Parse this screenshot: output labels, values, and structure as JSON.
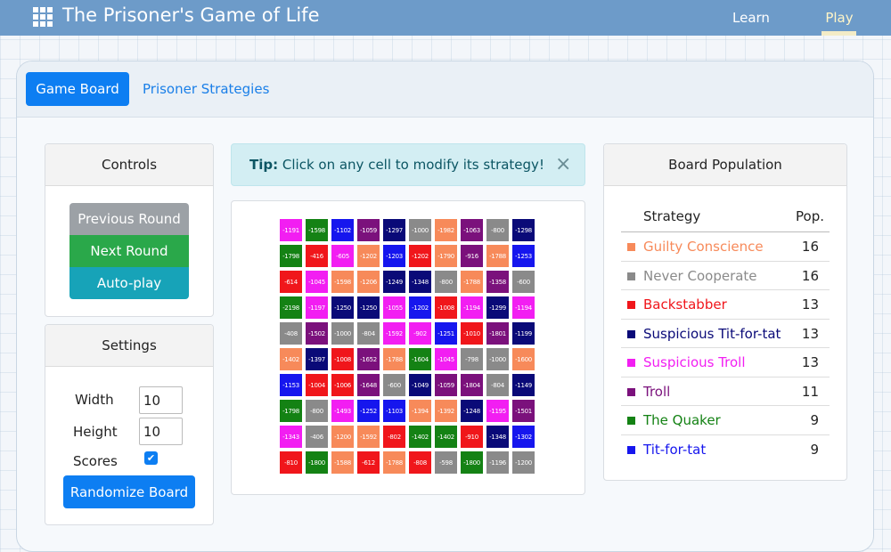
{
  "app": {
    "title": "The Prisoner's Game of Life"
  },
  "nav": {
    "learn": "Learn",
    "play": "Play"
  },
  "tabs": {
    "active": "Game Board",
    "other": "Prisoner Strategies"
  },
  "controls": {
    "title": "Controls",
    "previous": "Previous Round",
    "next": "Next Round",
    "autoplay": "Auto-play"
  },
  "settings": {
    "title": "Settings",
    "width_label": "Width",
    "width_value": "10",
    "height_label": "Height",
    "height_value": "10",
    "scores_label": "Scores",
    "scores_checked": true,
    "randomize": "Randomize Board"
  },
  "tip": {
    "label": "Tip:",
    "text": "Click on any cell to modify its strategy!",
    "close": "×"
  },
  "population": {
    "title": "Board Population",
    "col_strategy": "Strategy",
    "col_pop": "Pop.",
    "rows": [
      {
        "name": "Guilty Conscience",
        "count": "16",
        "color": "#f78a5a"
      },
      {
        "name": "Never Cooperate",
        "count": "16",
        "color": "#8a8a8a"
      },
      {
        "name": "Backstabber",
        "count": "13",
        "color": "#f0161b"
      },
      {
        "name": "Suspicious Tit-for-tat",
        "count": "13",
        "color": "#0a0a78"
      },
      {
        "name": "Suspicious Troll",
        "count": "13",
        "color": "#f21ef2"
      },
      {
        "name": "Troll",
        "count": "11",
        "color": "#7b117c"
      },
      {
        "name": "The Quaker",
        "count": "9",
        "color": "#148214"
      },
      {
        "name": "Tit-for-tat",
        "count": "9",
        "color": "#1616ee"
      }
    ]
  },
  "board": {
    "colors": {
      "P": "#f21ef2",
      "G": "#148214",
      "B": "#1616ee",
      "U": "#7b117c",
      "N": "#0a0a78",
      "Y": "#8a8a8a",
      "O": "#f78a5a",
      "R": "#f0161b"
    },
    "cells": [
      [
        [
          "P",
          "-1191"
        ],
        [
          "G",
          "-1598"
        ],
        [
          "B",
          "-1102"
        ],
        [
          "U",
          "-1059"
        ],
        [
          "N",
          "-1297"
        ],
        [
          "Y",
          "-1000"
        ],
        [
          "O",
          "-1982"
        ],
        [
          "U",
          "-1063"
        ],
        [
          "Y",
          "-800"
        ],
        [
          "N",
          "-1298"
        ]
      ],
      [
        [
          "G",
          "-1798"
        ],
        [
          "R",
          "-416"
        ],
        [
          "P",
          "-605"
        ],
        [
          "O",
          "-1202"
        ],
        [
          "B",
          "-1203"
        ],
        [
          "R",
          "-1202"
        ],
        [
          "O",
          "-1790"
        ],
        [
          "U",
          "-916"
        ],
        [
          "O",
          "-1788"
        ],
        [
          "B",
          "-1253"
        ]
      ],
      [
        [
          "R",
          "-614"
        ],
        [
          "P",
          "-1045"
        ],
        [
          "O",
          "-1598"
        ],
        [
          "O",
          "-1206"
        ],
        [
          "N",
          "-1249"
        ],
        [
          "N",
          "-1348"
        ],
        [
          "Y",
          "-800"
        ],
        [
          "O",
          "-1788"
        ],
        [
          "U",
          "-1358"
        ],
        [
          "Y",
          "-600"
        ]
      ],
      [
        [
          "G",
          "-2198"
        ],
        [
          "P",
          "-1197"
        ],
        [
          "N",
          "-1250"
        ],
        [
          "N",
          "-1250"
        ],
        [
          "P",
          "-1055"
        ],
        [
          "B",
          "-1202"
        ],
        [
          "R",
          "-1008"
        ],
        [
          "P",
          "-1194"
        ],
        [
          "N",
          "-1299"
        ],
        [
          "P",
          "-1194"
        ]
      ],
      [
        [
          "Y",
          "-408"
        ],
        [
          "U",
          "-1502"
        ],
        [
          "Y",
          "-1000"
        ],
        [
          "Y",
          "-804"
        ],
        [
          "P",
          "-1592"
        ],
        [
          "P",
          "-902"
        ],
        [
          "B",
          "-1251"
        ],
        [
          "R",
          "-1010"
        ],
        [
          "U",
          "-1801"
        ],
        [
          "N",
          "-1199"
        ]
      ],
      [
        [
          "O",
          "-1402"
        ],
        [
          "N",
          "-1397"
        ],
        [
          "R",
          "-1008"
        ],
        [
          "U",
          "-1652"
        ],
        [
          "O",
          "-1788"
        ],
        [
          "G",
          "-1604"
        ],
        [
          "P",
          "-1045"
        ],
        [
          "Y",
          "-798"
        ],
        [
          "Y",
          "-1000"
        ],
        [
          "O",
          "-1600"
        ]
      ],
      [
        [
          "B",
          "-1153"
        ],
        [
          "R",
          "-1004"
        ],
        [
          "R",
          "-1006"
        ],
        [
          "U",
          "-1648"
        ],
        [
          "Y",
          "-600"
        ],
        [
          "N",
          "-1049"
        ],
        [
          "U",
          "-1059"
        ],
        [
          "U",
          "-1804"
        ],
        [
          "Y",
          "-804"
        ],
        [
          "N",
          "-1149"
        ]
      ],
      [
        [
          "G",
          "-1798"
        ],
        [
          "Y",
          "-800"
        ],
        [
          "P",
          "-1493"
        ],
        [
          "B",
          "-1252"
        ],
        [
          "B",
          "-1103"
        ],
        [
          "O",
          "-1394"
        ],
        [
          "O",
          "-1392"
        ],
        [
          "N",
          "-1248"
        ],
        [
          "P",
          "-1195"
        ],
        [
          "U",
          "-1501"
        ]
      ],
      [
        [
          "P",
          "-1343"
        ],
        [
          "Y",
          "-406"
        ],
        [
          "O",
          "-1200"
        ],
        [
          "O",
          "-1592"
        ],
        [
          "R",
          "-802"
        ],
        [
          "G",
          "-1402"
        ],
        [
          "G",
          "-1402"
        ],
        [
          "R",
          "-910"
        ],
        [
          "N",
          "-1348"
        ],
        [
          "B",
          "-1302"
        ]
      ],
      [
        [
          "R",
          "-810"
        ],
        [
          "G",
          "-1800"
        ],
        [
          "O",
          "-1588"
        ],
        [
          "R",
          "-612"
        ],
        [
          "O",
          "-1788"
        ],
        [
          "R",
          "-808"
        ],
        [
          "Y",
          "-598"
        ],
        [
          "G",
          "-1800"
        ],
        [
          "Y",
          "-1196"
        ],
        [
          "Y",
          "-1200"
        ]
      ]
    ]
  }
}
